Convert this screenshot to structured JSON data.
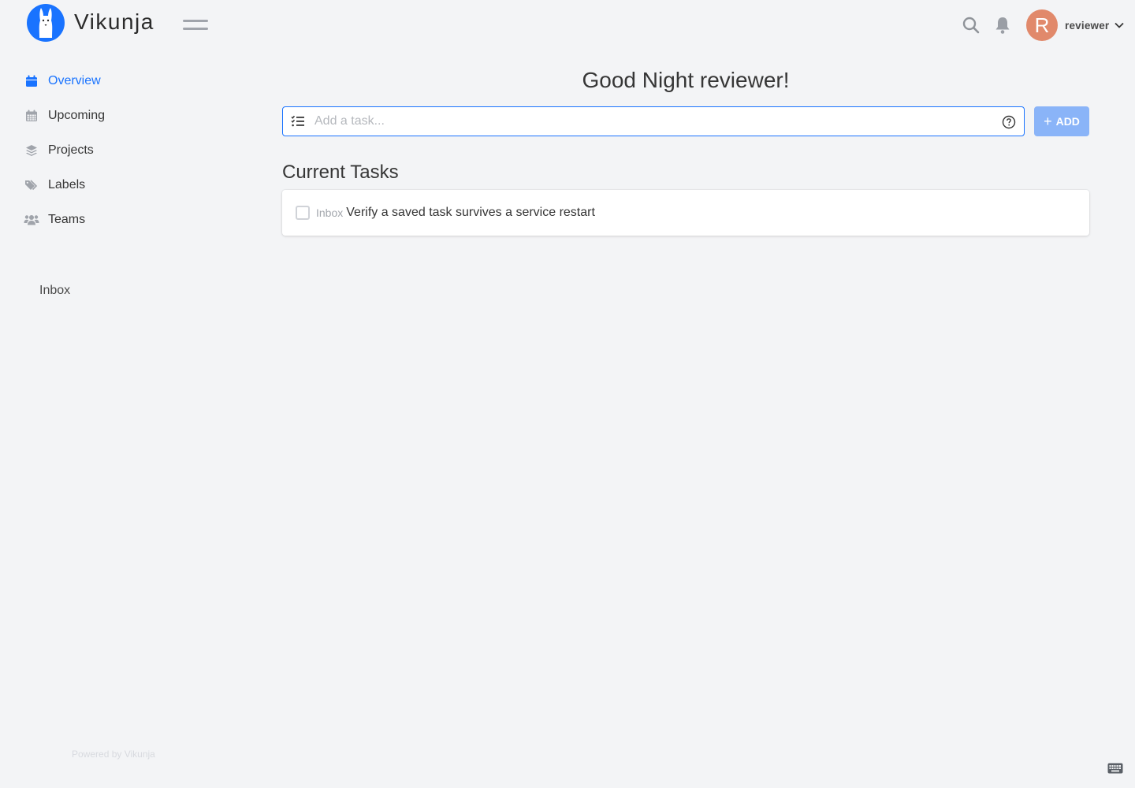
{
  "app": {
    "name": "Vikunja"
  },
  "header": {
    "username": "reviewer",
    "avatar_initial": "R",
    "avatar_color": "#e1896b",
    "icons": [
      "search-icon",
      "bell-icon",
      "chevron-down-icon"
    ]
  },
  "sidebar": {
    "items": [
      {
        "label": "Overview",
        "icon": "calendar-icon",
        "active": true
      },
      {
        "label": "Upcoming",
        "icon": "calendar-grid-icon",
        "active": false
      },
      {
        "label": "Projects",
        "icon": "layers-icon",
        "active": false
      },
      {
        "label": "Labels",
        "icon": "tags-icon",
        "active": false
      },
      {
        "label": "Teams",
        "icon": "users-icon",
        "active": false
      }
    ],
    "projects": [
      "Inbox"
    ],
    "footer": "Powered by Vikunja"
  },
  "main": {
    "greeting": "Good Night reviewer!",
    "add_task": {
      "placeholder": "Add a task...",
      "button_label": "ADD"
    },
    "section_title": "Current Tasks",
    "tasks": [
      {
        "project": "Inbox",
        "title": "Verify a saved task survives a service restart",
        "done": false
      }
    ]
  },
  "colors": {
    "accent": "#1973ff",
    "add_button": "#8ab4f8",
    "background": "#f3f4f6"
  }
}
